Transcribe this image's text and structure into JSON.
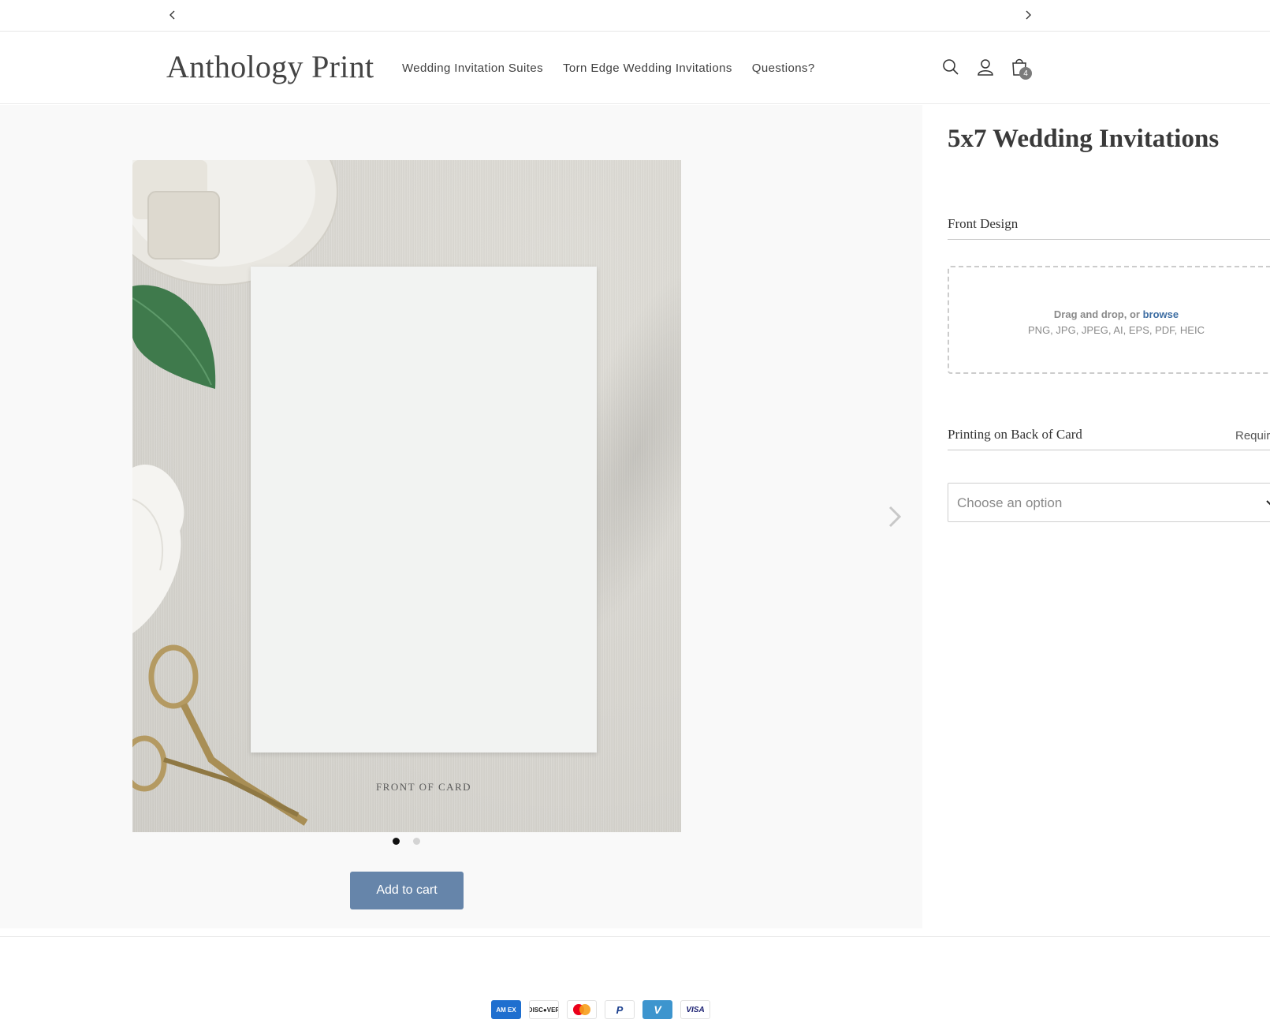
{
  "store": {
    "name": "Anthology Print"
  },
  "nav": [
    {
      "label": "Wedding Invitation Suites"
    },
    {
      "label": "Torn Edge Wedding Invitations"
    },
    {
      "label": "Questions?"
    }
  ],
  "cart": {
    "count": "4"
  },
  "gallery": {
    "caption": "FRONT OF CARD",
    "slide_count": 2,
    "active_slide": 1
  },
  "product": {
    "title": "5x7 Wedding Invitations",
    "add_to_cart": "Add to cart",
    "front_design": {
      "label": "Front Design",
      "drop_text": "Drag and drop, or",
      "browse": "browse",
      "formats": "PNG, JPG, JPEG, AI, EPS, PDF, HEIC"
    },
    "back_printing": {
      "label": "Printing on Back of Card",
      "required": "Requir",
      "placeholder": "Choose an option"
    }
  },
  "payments": [
    {
      "name": "American Express",
      "text": "AM EX",
      "bg": "#1f6fcf",
      "fg": "#ffffff"
    },
    {
      "name": "Discover",
      "text": "DISC●VER",
      "bg": "#ffffff",
      "fg": "#222222"
    },
    {
      "name": "Mastercard",
      "text": "",
      "bg": "#ffffff",
      "fg": "#222222"
    },
    {
      "name": "PayPal",
      "text": "P",
      "bg": "#ffffff",
      "fg": "#1b3f8e"
    },
    {
      "name": "Venmo",
      "text": "V",
      "bg": "#3d95ce",
      "fg": "#ffffff"
    },
    {
      "name": "Visa",
      "text": "VISA",
      "bg": "#ffffff",
      "fg": "#1a1f71"
    }
  ],
  "colors": {
    "accent": "#6685aa",
    "link": "#3e6ea3"
  }
}
